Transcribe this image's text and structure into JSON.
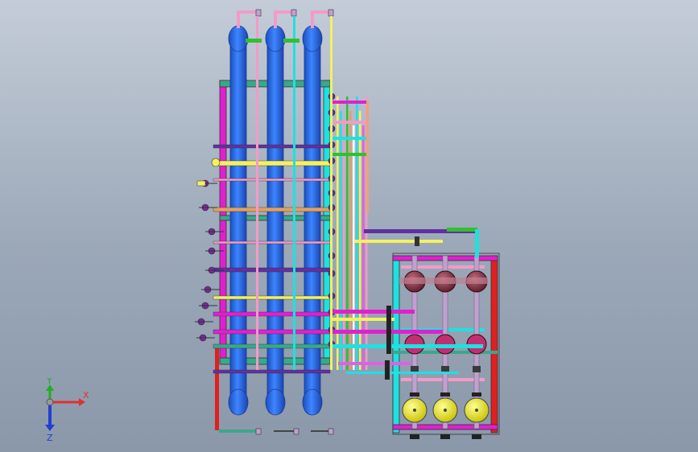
{
  "viewport": {
    "background_top": "#c4ccd8",
    "background_bottom": "#8a98aa"
  },
  "triad": {
    "x_label": "X",
    "y_label": "Y",
    "z_label": "Z",
    "x_color": "#e03030",
    "y_color": "#20b020",
    "z_color": "#2040d0"
  },
  "colors": {
    "column_blue": "#2f6fe6",
    "frame_magenta": "#e020d0",
    "frame_cyan": "#20e0e0",
    "frame_teal": "#3aa88a",
    "frame_red": "#e02020",
    "pipe_yellow": "#f4f060",
    "pipe_pink": "#f49ac8",
    "pipe_green": "#30c030",
    "pipe_orange": "#e0a060",
    "pipe_purple": "#6030a0",
    "tank_yellow": "#f2f020",
    "pump_maroon": "#8a2a3a"
  },
  "icons": [
    "coordinate-triad-icon"
  ]
}
